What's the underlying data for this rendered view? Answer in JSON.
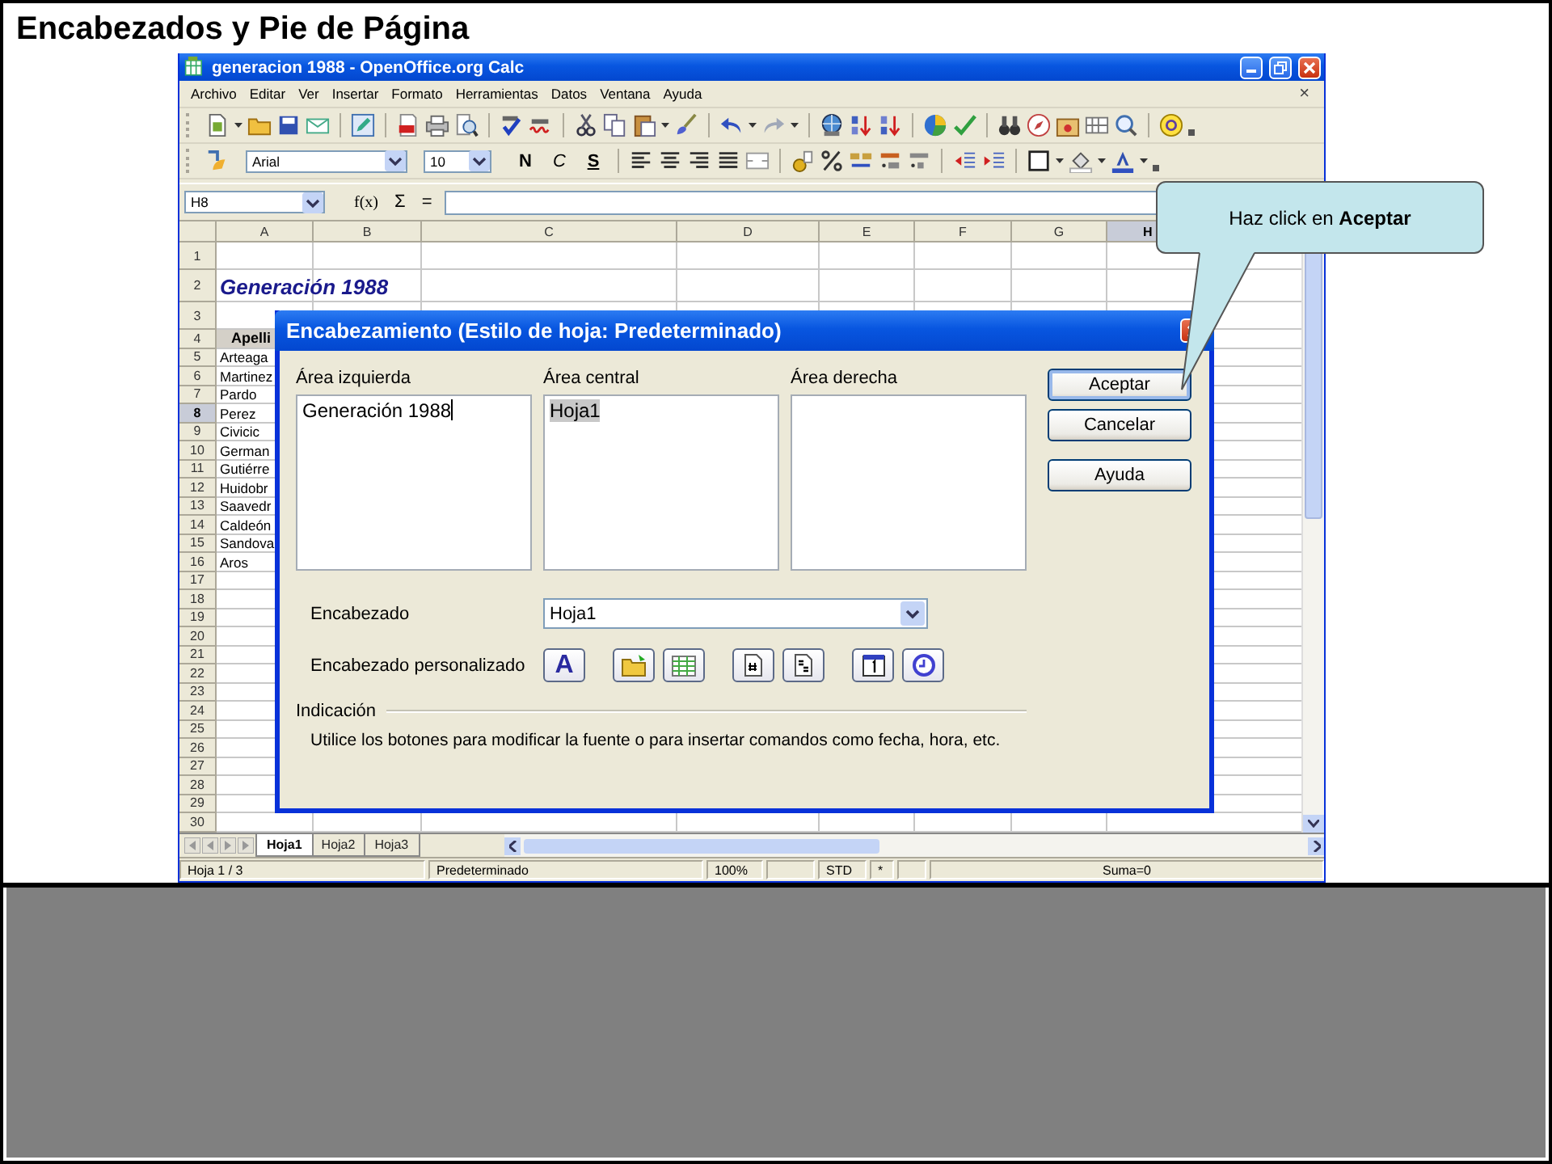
{
  "slide": {
    "title": "Encabezados y Pie de Página"
  },
  "window": {
    "title": "generacion 1988 - OpenOffice.org Calc"
  },
  "menu": [
    "Archivo",
    "Editar",
    "Ver",
    "Insertar",
    "Formato",
    "Herramientas",
    "Datos",
    "Ventana",
    "Ayuda"
  ],
  "menu_close": "×",
  "format_bar": {
    "font": "Arial",
    "size": "10",
    "styles": [
      {
        "label": "N",
        "kind": "bold"
      },
      {
        "label": "C",
        "kind": "italic"
      },
      {
        "label": "S",
        "kind": "underline"
      }
    ]
  },
  "formula_bar": {
    "cell_ref": "H8",
    "function_wizard": "f(x)",
    "sum": "Σ",
    "equals": "="
  },
  "sheet": {
    "columns": [
      {
        "label": "A",
        "selected": false
      },
      {
        "label": "B",
        "selected": false
      },
      {
        "label": "C",
        "selected": false
      },
      {
        "label": "D",
        "selected": false
      },
      {
        "label": "E",
        "selected": false
      },
      {
        "label": "F",
        "selected": false
      },
      {
        "label": "G",
        "selected": false
      },
      {
        "label": "H",
        "selected": true
      }
    ],
    "rows": [
      {
        "number": "1",
        "selected": false
      },
      {
        "number": "2",
        "selected": false,
        "cell": {
          "kind": "title",
          "text": "Generación 1988"
        }
      },
      {
        "number": "3",
        "selected": false
      },
      {
        "number": "4",
        "selected": false,
        "cell": {
          "kind": "header",
          "text": "Apelli"
        }
      },
      {
        "number": "5",
        "selected": false,
        "cell": {
          "kind": "plain",
          "text": "Arteaga"
        }
      },
      {
        "number": "6",
        "selected": false,
        "cell": {
          "kind": "plain",
          "text": "Martinez"
        }
      },
      {
        "number": "7",
        "selected": false,
        "cell": {
          "kind": "plain",
          "text": "Pardo"
        }
      },
      {
        "number": "8",
        "selected": true,
        "cell": {
          "kind": "plain",
          "text": "Perez"
        }
      },
      {
        "number": "9",
        "selected": false,
        "cell": {
          "kind": "plain",
          "text": "Civicic"
        }
      },
      {
        "number": "10",
        "selected": false,
        "cell": {
          "kind": "plain",
          "text": "German"
        }
      },
      {
        "number": "11",
        "selected": false,
        "cell": {
          "kind": "plain",
          "text": "Gutiérre"
        }
      },
      {
        "number": "12",
        "selected": false,
        "cell": {
          "kind": "plain",
          "text": "Huidobr"
        }
      },
      {
        "number": "13",
        "selected": false,
        "cell": {
          "kind": "plain",
          "text": "Saavedr"
        }
      },
      {
        "number": "14",
        "selected": false,
        "cell": {
          "kind": "plain",
          "text": "Caldeón"
        }
      },
      {
        "number": "15",
        "selected": false,
        "cell": {
          "kind": "plain",
          "text": "Sandova"
        }
      },
      {
        "number": "16",
        "selected": false,
        "cell": {
          "kind": "plain",
          "text": "Aros"
        }
      },
      {
        "number": "17",
        "selected": false
      },
      {
        "number": "18",
        "selected": false
      },
      {
        "number": "19",
        "selected": false
      },
      {
        "number": "20",
        "selected": false
      },
      {
        "number": "21",
        "selected": false
      },
      {
        "number": "22",
        "selected": false
      },
      {
        "number": "23",
        "selected": false
      },
      {
        "number": "24",
        "selected": false
      },
      {
        "number": "25",
        "selected": false
      },
      {
        "number": "26",
        "selected": false
      },
      {
        "number": "27",
        "selected": false
      },
      {
        "number": "28",
        "selected": false
      },
      {
        "number": "29",
        "selected": false
      },
      {
        "number": "30",
        "selected": false
      }
    ]
  },
  "sheet_tabs": [
    {
      "label": "Hoja1",
      "selected": true
    },
    {
      "label": "Hoja2",
      "selected": false
    },
    {
      "label": "Hoja3",
      "selected": false
    }
  ],
  "status_bar": [
    "Hoja 1 / 3",
    "Predeterminado",
    "100%",
    "STD",
    "*",
    "Suma=0"
  ],
  "dialog": {
    "title": "Encabezamiento (Estilo de hoja: Predeterminado)",
    "areas": [
      {
        "label": "Área izquierda",
        "text": "Generación 1988",
        "caret": true,
        "highlighted": false
      },
      {
        "label": "Área central",
        "text": "Hoja1",
        "caret": false,
        "highlighted": true
      },
      {
        "label": "Área derecha",
        "caret": false,
        "highlighted": false
      }
    ],
    "buttons": [
      {
        "label": "Aceptar",
        "default": true
      },
      {
        "label": "Cancelar",
        "default": false
      },
      {
        "label": "Ayuda",
        "default": false
      }
    ],
    "header_label": "Encabezado",
    "header_value": "Hoja1",
    "custom_label": "Encabezado personalizado",
    "custom_buttons": [
      {
        "kind": "font",
        "glyph": "A"
      },
      {
        "kind": "file"
      },
      {
        "kind": "sheet"
      },
      {
        "kind": "page"
      },
      {
        "kind": "pages"
      },
      {
        "kind": "date"
      },
      {
        "kind": "time"
      }
    ],
    "hint_title": "Indicación",
    "hint_text": "Utilice los botones para modificar la fuente o para insertar comandos como fecha, hora, etc."
  },
  "callout": {
    "text": "Haz click en **Aceptar**"
  }
}
